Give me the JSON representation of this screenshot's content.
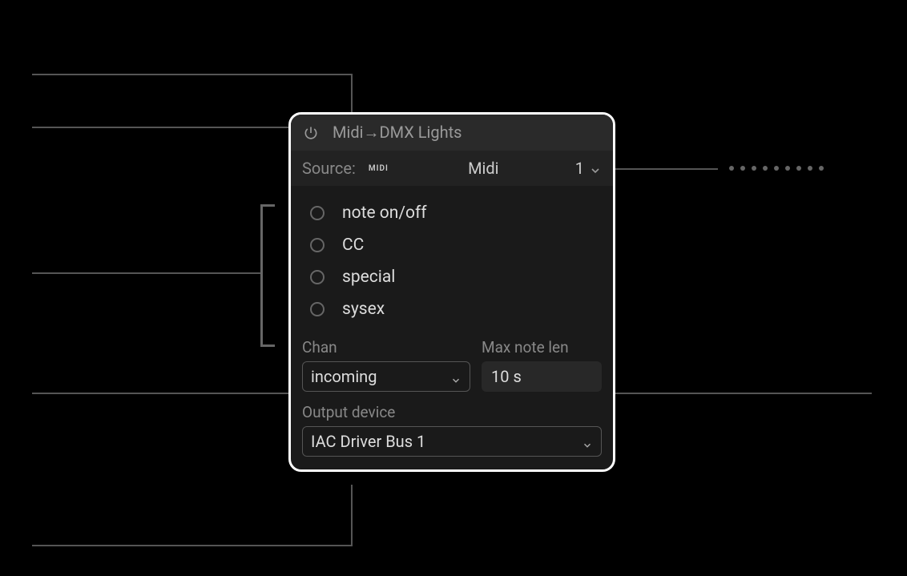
{
  "panel": {
    "title": "Midi→DMX Lights"
  },
  "source": {
    "label": "Source:",
    "badge": "MIDI",
    "name": "Midi",
    "port": "1"
  },
  "message_types": [
    {
      "label": "note on/off"
    },
    {
      "label": "CC"
    },
    {
      "label": "special"
    },
    {
      "label": "sysex"
    }
  ],
  "channel": {
    "label": "Chan",
    "value": "incoming"
  },
  "max_note_len": {
    "label": "Max note len",
    "value": "10 s"
  },
  "output": {
    "label": "Output device",
    "value": "IAC Driver Bus 1"
  }
}
